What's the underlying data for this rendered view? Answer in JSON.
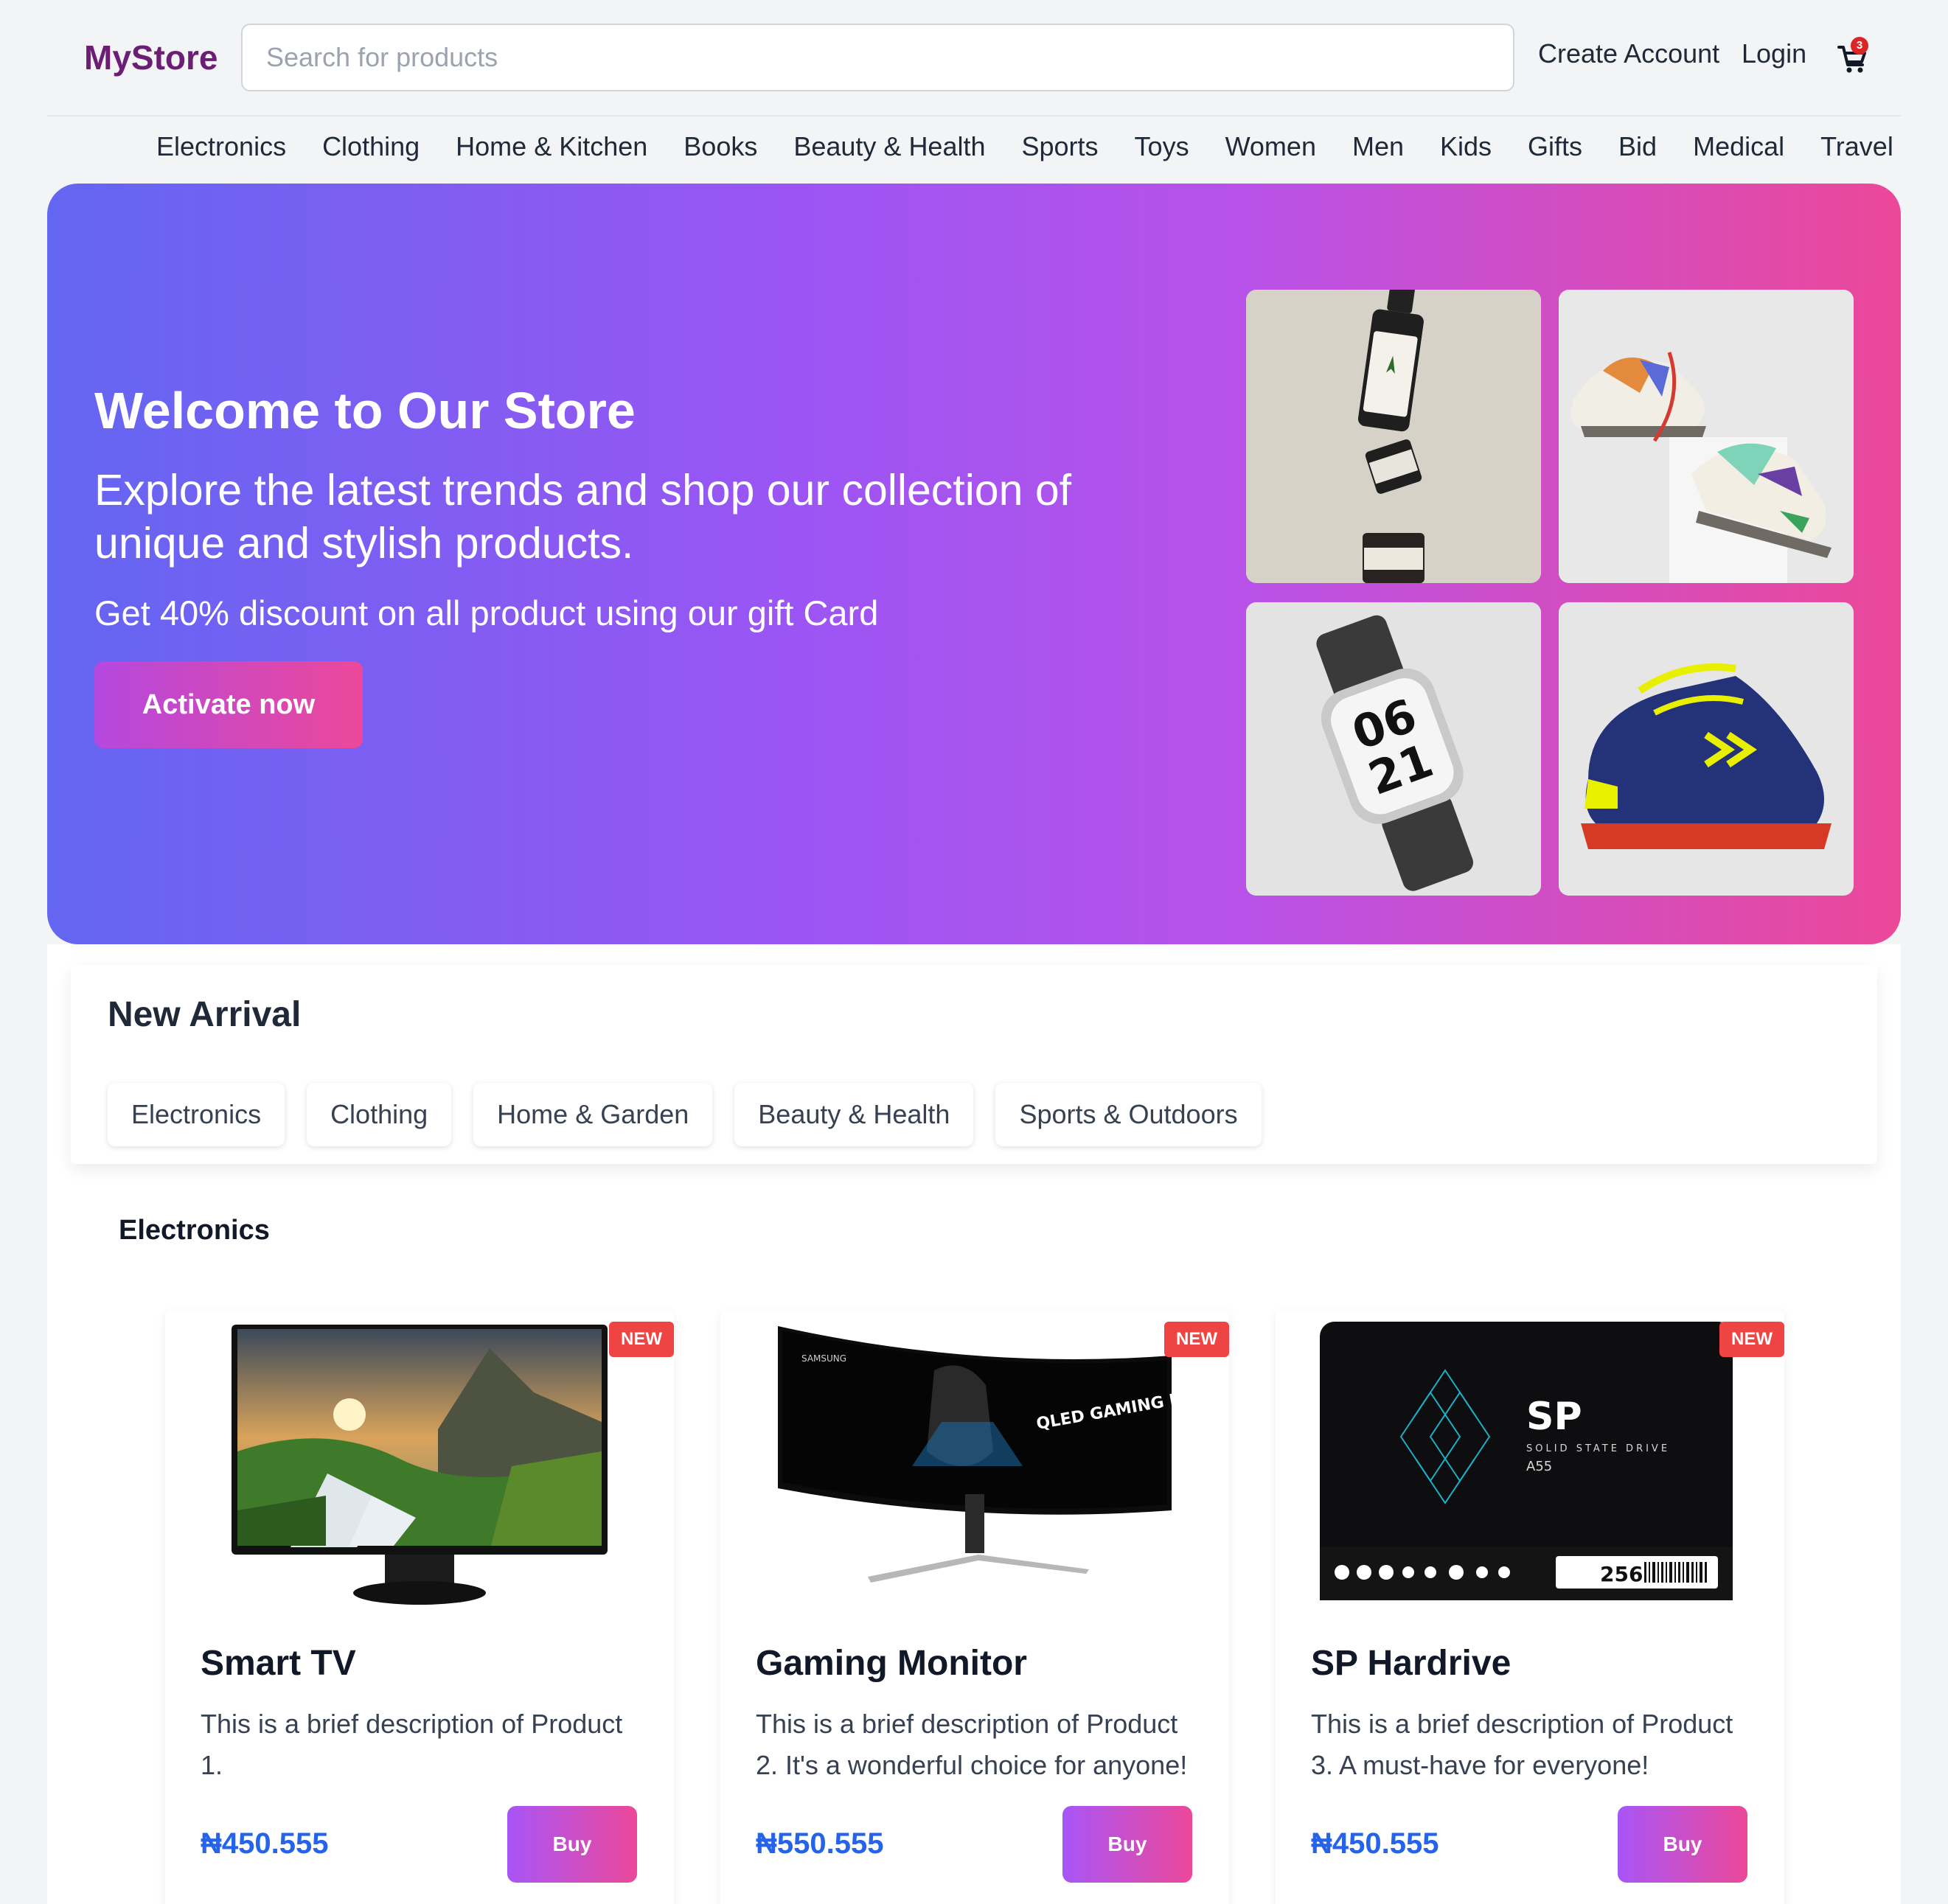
{
  "brand": {
    "name": "MyStore",
    "color": "#6b1e74"
  },
  "header": {
    "search_placeholder": "Search for products",
    "create_account": "Create Account",
    "login": "Login",
    "cart_count": "3"
  },
  "categories": [
    "Electronics",
    "Clothing",
    "Home & Kitchen",
    "Books",
    "Beauty & Health",
    "Sports",
    "Toys",
    "Women",
    "Men",
    "Kids",
    "Gifts",
    "Bid",
    "Medical",
    "Travel"
  ],
  "hero": {
    "title": "Welcome to Our Store",
    "subtitle": "Explore the latest trends and shop our collection of unique and stylish products.",
    "offer": "Get 40% discount on all product using our gift Card",
    "button": "Activate now",
    "tiles": [
      "hemp-seed-bottles-image",
      "sneakers-pair-image",
      "smartwatch-image",
      "blue-sneaker-image"
    ]
  },
  "new_arrival": {
    "title": "New Arrival",
    "filters": [
      "Electronics",
      "Clothing",
      "Home & Garden",
      "Beauty & Health",
      "Sports & Outdoors"
    ]
  },
  "section": {
    "title": "Electronics"
  },
  "products": [
    {
      "badge": "NEW",
      "name": "Smart TV",
      "description": "This is a brief description of Product 1.",
      "price": "₦450.555",
      "button": "Buy",
      "image": "monitor-landscape-image"
    },
    {
      "badge": "NEW",
      "name": "Gaming Monitor",
      "description": "This is a brief description of Product 2. It's a wonderful choice for anyone!",
      "price": "₦550.555",
      "button": "Buy",
      "image": "curved-gaming-monitor-image",
      "image_text": "QLED GAMING MONITOR",
      "image_brand": "SAMSUNG"
    },
    {
      "badge": "NEW",
      "name": "SP Hardrive",
      "description": "This is a brief description of Product 3. A must-have for everyone!",
      "price": "₦450.555",
      "button": "Buy",
      "image": "ssd-drive-image",
      "image_text": "SOLID STATE DRIVE",
      "image_model": "A55",
      "image_capacity": "256"
    }
  ],
  "colors": {
    "accent_pink": "#ec4899",
    "accent_indigo": "#6366f1",
    "price_blue": "#2563eb",
    "badge_red": "#ef4444"
  }
}
